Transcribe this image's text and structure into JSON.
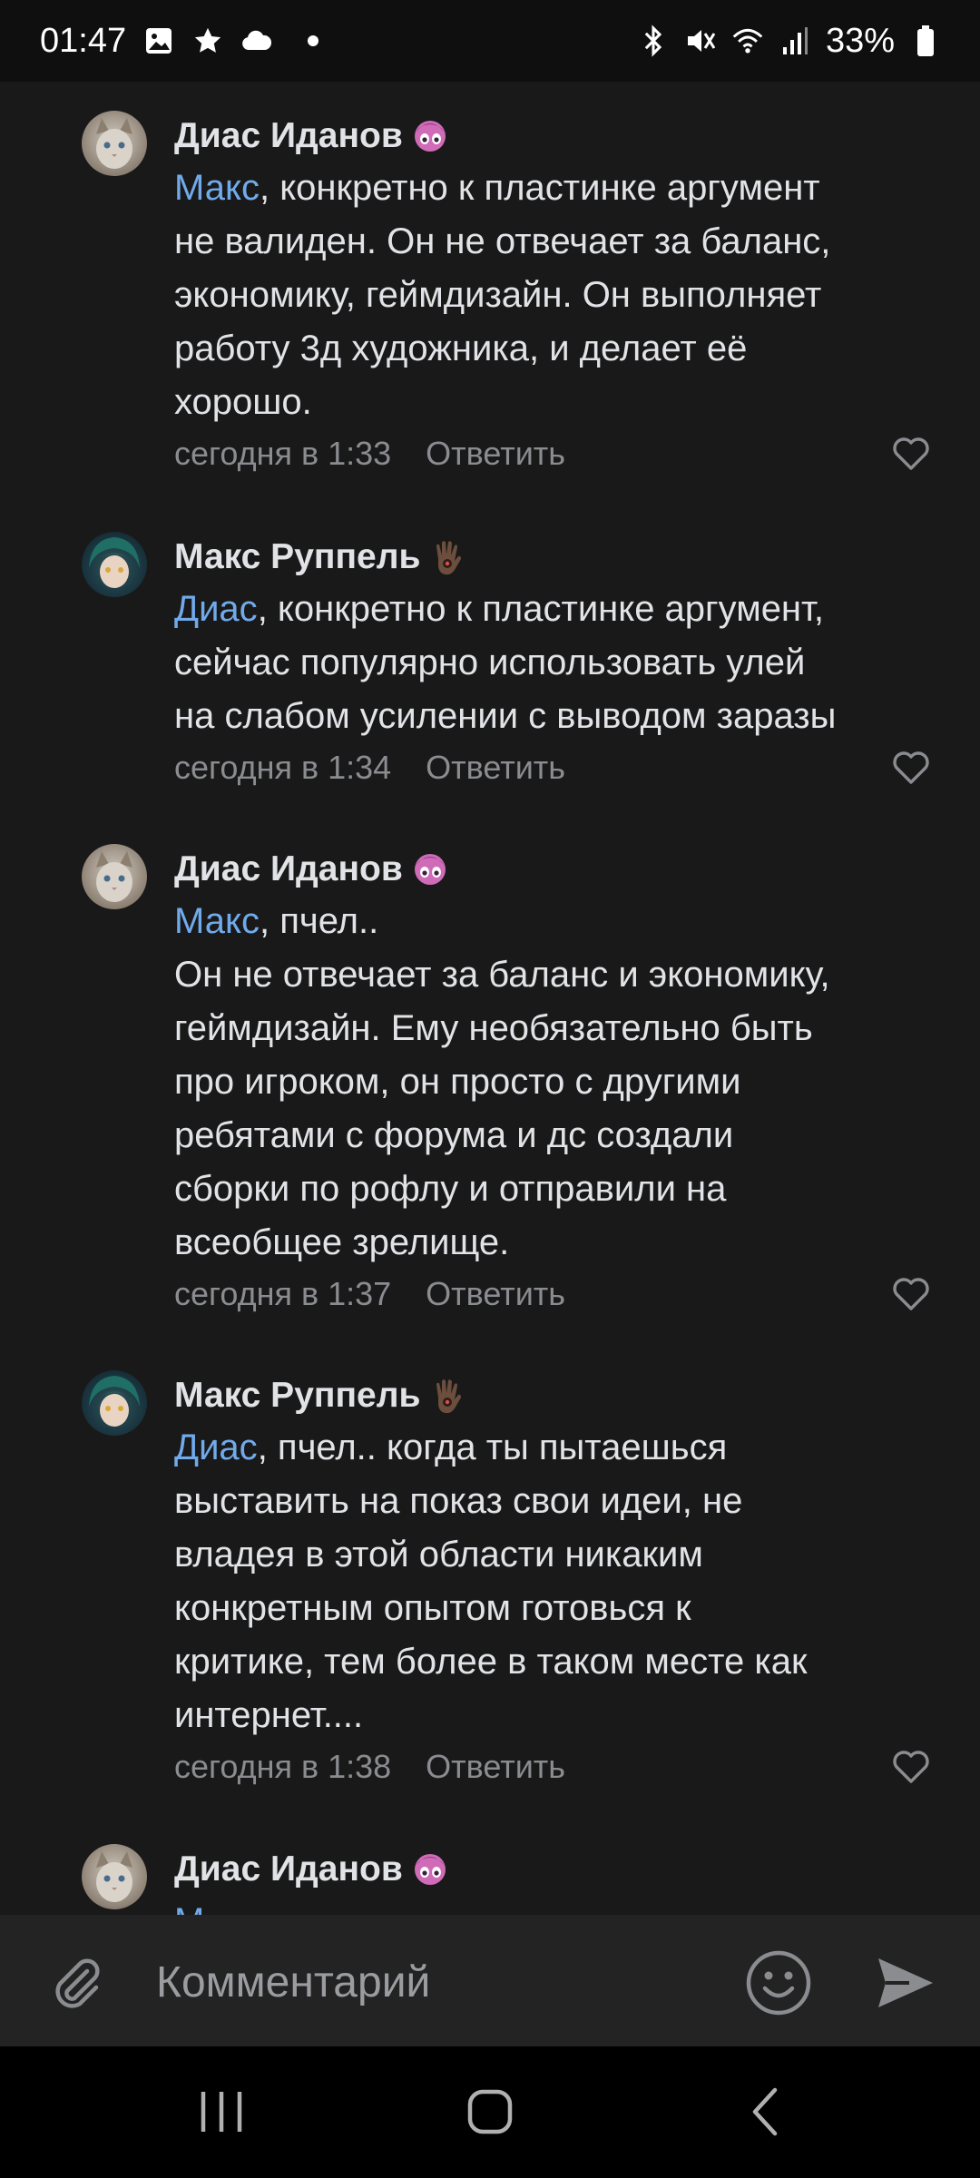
{
  "status_bar": {
    "time": "01:47",
    "battery": "33%",
    "icons_left": [
      "gallery-icon",
      "star-icon",
      "cloud-icon",
      "dot-icon"
    ],
    "icons_right": [
      "bluetooth-icon",
      "mute-icon",
      "wifi-icon",
      "signal-icon",
      "battery-icon"
    ]
  },
  "comments": [
    {
      "author": "Диас Иданов",
      "avatar": "cat-avatar",
      "mention": "Макс",
      "text": ", конкретно к пластинке аргумент\nне валиден. Он не отвечает за баланс,\nэкономику, геймдизайн. Он выполняет\nработу 3д художника, и делает её\nхорошо.",
      "time": "сегодня в 1:33",
      "reply": "Ответить"
    },
    {
      "author": "Макс Руппель",
      "avatar": "anime-avatar",
      "mention": "Диас",
      "text": ", конкретно к пластинке аргумент,\nсейчас популярно использовать улей\nна слабом усилении с выводом заразы",
      "time": "сегодня в 1:34",
      "reply": "Ответить"
    },
    {
      "author": "Диас Иданов",
      "avatar": "cat-avatar",
      "mention": "Макс",
      "text": ", пчел..\nОн не отвечает за баланс и экономику,\nгеймдизайн. Ему необязательно быть\nпро игроком, он просто с другими\nребятами с форума и дс создали\nсборки по рофлу и отправили на\nвсеобщее зрелище.",
      "time": "сегодня в 1:37",
      "reply": "Ответить"
    },
    {
      "author": "Макс Руппель",
      "avatar": "anime-avatar",
      "mention": "Диас",
      "text": ", пчел.. когда ты пытаешься\nвыставить на показ свои идеи, не\nвладея в этой области никаким\nконкретным опытом готовься к\nкритике, тем более в таком месте как\nинтернет....",
      "time": "сегодня в 1:38",
      "reply": "Ответить"
    },
    {
      "author": "Диас Иданов",
      "avatar": "cat-avatar",
      "mention": "М",
      "text": "",
      "time": "",
      "reply": ""
    }
  ],
  "composer": {
    "placeholder": "Комментарий"
  },
  "colors": {
    "background": "#191919",
    "mention": "#71aaeb",
    "meta": "#8a8c90",
    "composer": "#232324"
  }
}
